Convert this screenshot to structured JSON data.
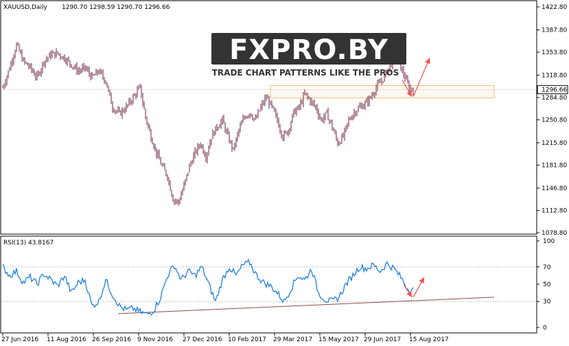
{
  "header": {
    "symbol_info": "XAUUSD,Daily",
    "ohlc": "1290.70 1298.59 1290.70 1296.66"
  },
  "rsi_label": "RSI(13) 43.8167",
  "logo": {
    "text": "FXPRO.BY",
    "tagline": "TRADE CHART PATTERNS LIKE THE PROS"
  },
  "colors": {
    "background": "#ffffff",
    "candles": "#6b1f3f",
    "rsi_line": "#1e7fe0",
    "trendline": "#8b4a4a",
    "arrow": "#f05050",
    "zone_border": "#f3c078",
    "zone_fill": "#fdf3e2",
    "current_price_bg": "#ffffff"
  },
  "chart_data": [
    {
      "type": "candlestick",
      "symbol": "XAUUSD",
      "timeframe": "Daily",
      "ylim": [
        1078.8,
        1422.8
      ],
      "yticks": [
        1422.8,
        1387.8,
        1353.8,
        1318.8,
        1284.8,
        1250.8,
        1215.8,
        1181.8,
        1146.8,
        1112.8,
        1078.8
      ],
      "ytick_labels": [
        "1422.80",
        "1387.80",
        "1353.80",
        "1318.80",
        "1284.80",
        "1250.80",
        "1215.80",
        "1181.80",
        "1146.80",
        "1112.80",
        "1078.80"
      ],
      "current_price": 1296.66,
      "current_price_label": "1296.66",
      "xtick_labels": [
        "27 Jun 2016",
        "11 Aug 2016",
        "26 Sep 2016",
        "9 Nov 2016",
        "27 Dec 2016",
        "10 Feb 2017",
        "29 Mar 2017",
        "15 May 2017",
        "29 Jun 2017",
        "15 Aug 2017"
      ],
      "xtick_index": [
        0,
        33,
        66,
        99,
        132,
        165,
        198,
        231,
        264,
        297
      ],
      "close_path": [
        [
          0,
          1300
        ],
        [
          5,
          1330
        ],
        [
          10,
          1365
        ],
        [
          15,
          1340
        ],
        [
          20,
          1330
        ],
        [
          25,
          1315
        ],
        [
          30,
          1340
        ],
        [
          35,
          1350
        ],
        [
          40,
          1352
        ],
        [
          45,
          1345
        ],
        [
          50,
          1335
        ],
        [
          55,
          1325
        ],
        [
          60,
          1330
        ],
        [
          65,
          1315
        ],
        [
          70,
          1325
        ],
        [
          75,
          1310
        ],
        [
          80,
          1270
        ],
        [
          85,
          1260
        ],
        [
          90,
          1270
        ],
        [
          95,
          1285
        ],
        [
          100,
          1300
        ],
        [
          104,
          1255
        ],
        [
          108,
          1225
        ],
        [
          112,
          1200
        ],
        [
          116,
          1180
        ],
        [
          120,
          1165
        ],
        [
          124,
          1130
        ],
        [
          128,
          1125
        ],
        [
          132,
          1150
        ],
        [
          136,
          1180
        ],
        [
          140,
          1200
        ],
        [
          144,
          1215
        ],
        [
          148,
          1195
        ],
        [
          152,
          1225
        ],
        [
          156,
          1240
        ],
        [
          160,
          1250
        ],
        [
          164,
          1225
        ],
        [
          168,
          1205
        ],
        [
          172,
          1235
        ],
        [
          176,
          1255
        ],
        [
          180,
          1262
        ],
        [
          184,
          1250
        ],
        [
          188,
          1270
        ],
        [
          192,
          1285
        ],
        [
          196,
          1270
        ],
        [
          200,
          1250
        ],
        [
          204,
          1225
        ],
        [
          208,
          1235
        ],
        [
          212,
          1262
        ],
        [
          216,
          1270
        ],
        [
          220,
          1290
        ],
        [
          224,
          1280
        ],
        [
          228,
          1270
        ],
        [
          232,
          1250
        ],
        [
          236,
          1260
        ],
        [
          240,
          1240
        ],
        [
          244,
          1215
        ],
        [
          248,
          1225
        ],
        [
          252,
          1250
        ],
        [
          256,
          1262
        ],
        [
          260,
          1270
        ],
        [
          264,
          1275
        ],
        [
          268,
          1285
        ],
        [
          272,
          1300
        ],
        [
          276,
          1310
        ],
        [
          280,
          1325
        ],
        [
          284,
          1340
        ],
        [
          287,
          1355
        ],
        [
          290,
          1330
        ],
        [
          293,
          1315
        ],
        [
          296,
          1300
        ],
        [
          299,
          1296.66
        ]
      ],
      "annotations": {
        "zone": {
          "x_start": 195,
          "x_end": 358,
          "y_low": 1284,
          "y_high": 1303
        },
        "arrow_down": {
          "from": [
            291,
            1311
          ],
          "to": [
            298,
            1286
          ]
        },
        "arrow_up": {
          "from": [
            299,
            1286
          ],
          "to": [
            311,
            1345
          ]
        }
      }
    },
    {
      "type": "line",
      "name": "RSI(13)",
      "value": 43.8167,
      "ylim": [
        0,
        100
      ],
      "yticks": [
        100,
        70,
        50,
        30,
        0
      ],
      "ytick_labels": [
        "100",
        "70",
        "50",
        "30",
        "0"
      ],
      "x": [
        0,
        5,
        10,
        15,
        20,
        25,
        30,
        35,
        40,
        45,
        50,
        55,
        60,
        65,
        70,
        75,
        80,
        85,
        90,
        95,
        100,
        105,
        110,
        115,
        120,
        125,
        130,
        135,
        140,
        145,
        150,
        155,
        160,
        165,
        170,
        175,
        180,
        185,
        190,
        195,
        200,
        205,
        210,
        215,
        220,
        225,
        230,
        235,
        240,
        245,
        250,
        255,
        260,
        265,
        270,
        275,
        280,
        285,
        290,
        295,
        299
      ],
      "values": [
        70,
        60,
        65,
        52,
        58,
        50,
        62,
        55,
        48,
        60,
        40,
        52,
        55,
        25,
        30,
        55,
        38,
        25,
        20,
        22,
        18,
        15,
        20,
        35,
        60,
        72,
        55,
        65,
        60,
        70,
        50,
        30,
        55,
        70,
        60,
        72,
        75,
        60,
        52,
        48,
        40,
        30,
        45,
        60,
        55,
        68,
        40,
        32,
        30,
        35,
        50,
        60,
        70,
        68,
        72,
        65,
        74,
        68,
        58,
        45,
        43.8167
      ],
      "trendline": {
        "from": [
          84,
          16
        ],
        "to": [
          358,
          35
        ]
      },
      "arrow_down": {
        "from": [
          292,
          50
        ],
        "to": [
          298,
          35
        ]
      },
      "arrow_up": {
        "from": [
          299,
          35
        ],
        "to": [
          307,
          58
        ]
      }
    }
  ]
}
